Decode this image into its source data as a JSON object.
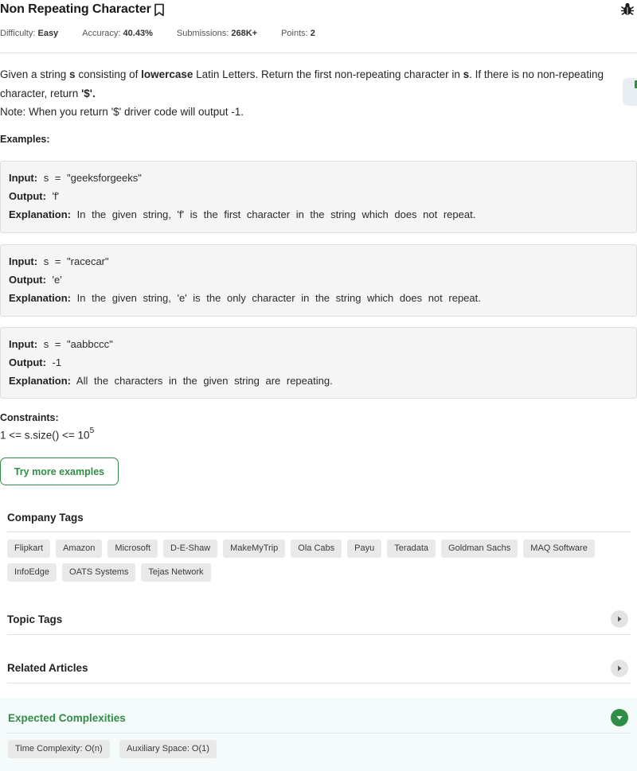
{
  "problem": {
    "title": "Non Repeating Character",
    "meta": {
      "difficulty_label": "Difficulty:",
      "difficulty_value": "Easy",
      "accuracy_label": "Accuracy:",
      "accuracy_value": "40.43%",
      "submissions_label": "Submissions:",
      "submissions_value": "268K+",
      "points_label": "Points:",
      "points_value": "2"
    },
    "desc": {
      "p1": "Given a string ",
      "s1": "s",
      "p2": " consisting of ",
      "lower": "lowercase",
      "p3": " Latin Letters. Return the first non-repeating character in ",
      "s2": "s",
      "p4": ". If there is no non-repeating character, return ",
      "dollar": "'$'.",
      "note": "Note: When you return '$' driver code will output -1."
    }
  },
  "examples": {
    "heading": "Examples:",
    "input_label": "Input:",
    "output_label": "Output:",
    "explanation_label": "Explanation:",
    "items": [
      {
        "input": "s = \"geeksforgeeks\"",
        "output": "'f'",
        "explanation": "In the given string, 'f' is the first character in the string which does not repeat."
      },
      {
        "input": "s = \"racecar\"",
        "output": "'e'",
        "explanation": "In the given string, 'e' is the only character in the string which does not repeat."
      },
      {
        "input": "s = \"aabbccc\"",
        "output": "-1",
        "explanation": "All the characters in the given string are repeating."
      }
    ]
  },
  "constraints": {
    "heading": "Constraints:",
    "text": "1 <= s.size() <= 10",
    "exp": "5"
  },
  "try_more_label": "Try more examples",
  "company_tags": {
    "heading": "Company Tags",
    "tags": [
      "Flipkart",
      "Amazon",
      "Microsoft",
      "D-E-Shaw",
      "MakeMyTrip",
      "Ola Cabs",
      "Payu",
      "Teradata",
      "Goldman Sachs",
      "MAQ Software",
      "InfoEdge",
      "OATS Systems",
      "Tejas Network"
    ]
  },
  "topic_tags": {
    "heading": "Topic Tags"
  },
  "related_articles": {
    "heading": "Related Articles"
  },
  "complexities": {
    "heading": "Expected Complexities",
    "time": "Time Complexity: O(n)",
    "space": "Auxiliary Space: O(1)"
  },
  "colors": {
    "accent": "#2f8d46",
    "tag_bg": "#e9e9e9",
    "example_bg": "#f5f5f5"
  },
  "icons": {
    "bookmark": "bookmark-icon",
    "bug": "bug-icon",
    "chevron_right": "chevron-right-icon",
    "chevron_down": "chevron-down-icon"
  }
}
